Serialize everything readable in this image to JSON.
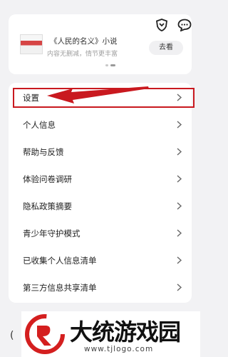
{
  "header": {
    "icons": [
      "shield-icon",
      "message-icon"
    ]
  },
  "promo": {
    "title": "《人民的名义》小说",
    "subtitle": "内容无删减，情节更丰富",
    "button": "去看"
  },
  "settings": {
    "items": [
      {
        "label": "设置"
      },
      {
        "label": "个人信息"
      },
      {
        "label": "帮助与反馈"
      },
      {
        "label": "体验问卷调研"
      },
      {
        "label": "隐私政策摘要"
      },
      {
        "label": "青少年守护模式"
      },
      {
        "label": "已收集个人信息清单"
      },
      {
        "label": "第三方信息共享清单"
      }
    ],
    "highlight_color": "#c9191f"
  },
  "watermark": {
    "title": "大统游戏园",
    "url": "www.tjlogo.com"
  },
  "bottom_fragment": "("
}
